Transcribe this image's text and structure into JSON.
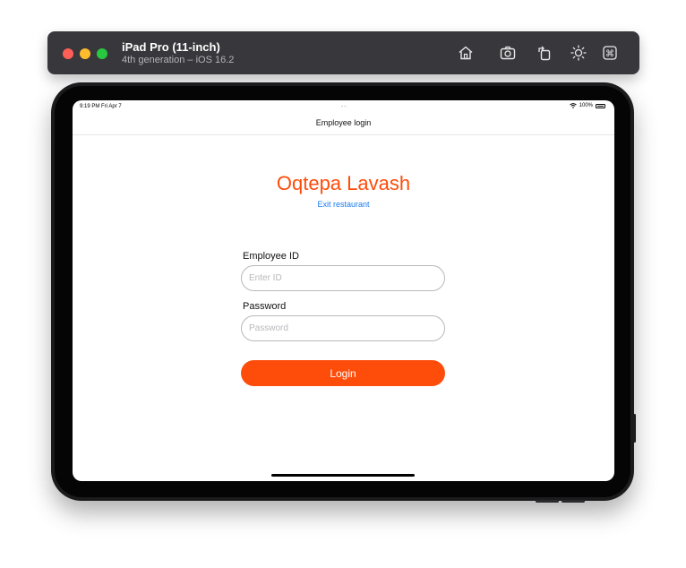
{
  "simulator": {
    "device_name": "iPad Pro (11-inch)",
    "device_info": "4th generation – iOS 16.2",
    "toolbar_icons": [
      "home-icon",
      "screenshot-icon",
      "rotate-icon",
      "appearance-icon",
      "keyboard-icon"
    ]
  },
  "status_bar": {
    "time_date": "9:19 PM  Fri Apr 7",
    "battery": "100%"
  },
  "nav": {
    "title": "Employee login"
  },
  "restaurant": {
    "name": "Oqtepa Lavash",
    "exit_label": "Exit restaurant"
  },
  "form": {
    "employee_id_label": "Employee ID",
    "employee_id_placeholder": "Enter ID",
    "employee_id_value": "",
    "password_label": "Password",
    "password_placeholder": "Password",
    "password_value": "",
    "login_label": "Login"
  },
  "colors": {
    "accent": "#fe4c0a",
    "link": "#1a7cf0",
    "toolbar": "#38373b"
  }
}
